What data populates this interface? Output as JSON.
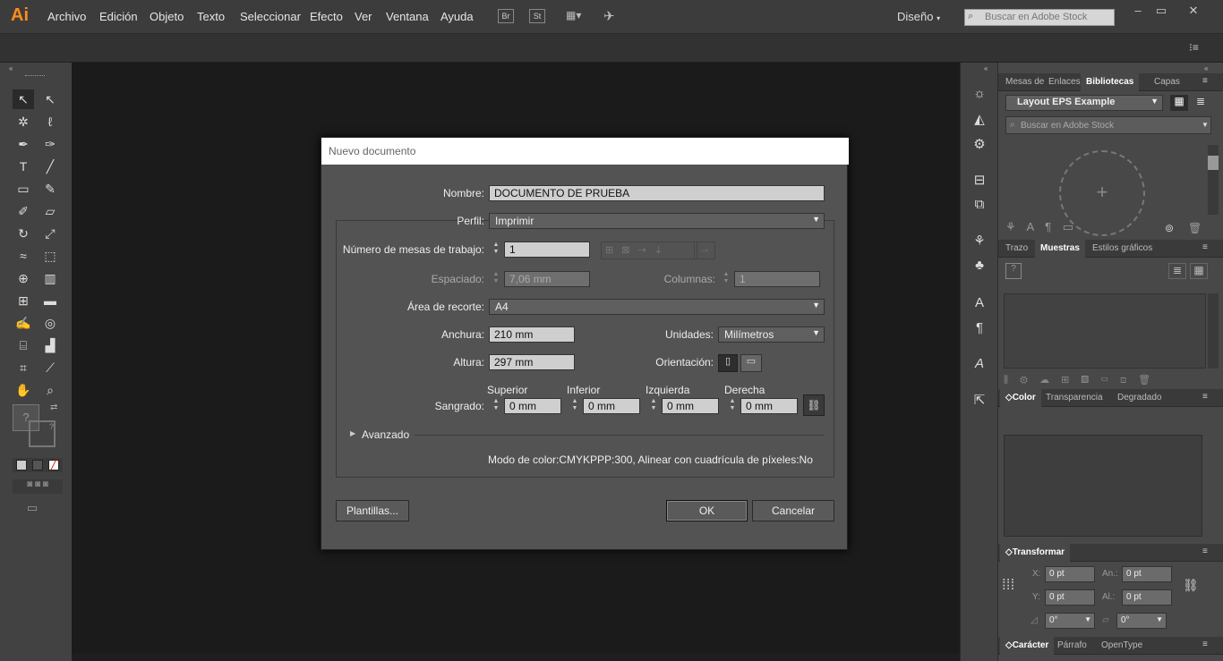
{
  "app": {
    "logo": "Ai",
    "menu": [
      "Archivo",
      "Edición",
      "Objeto",
      "Texto",
      "Seleccionar",
      "Efecto",
      "Ver",
      "Ventana",
      "Ayuda"
    ],
    "br": "Br",
    "st": "St",
    "workspace": "Diseño",
    "stock_search_placeholder": "Buscar en Adobe Stock"
  },
  "dialog": {
    "title": "Nuevo documento",
    "nombre_label": "Nombre:",
    "nombre_value": "DOCUMENTO DE PRUEBA",
    "perfil_label": "Perfil:",
    "perfil_value": "Imprimir",
    "mesas_label": "Número de mesas de trabajo:",
    "mesas_value": "1",
    "espaciado_label": "Espaciado:",
    "espaciado_value": "7,06 mm",
    "columnas_label": "Columnas:",
    "columnas_value": "1",
    "area_label": "Área de recorte:",
    "area_value": "A4",
    "anchura_label": "Anchura:",
    "anchura_value": "210 mm",
    "unidades_label": "Unidades:",
    "unidades_value": "Milímetros",
    "altura_label": "Altura:",
    "altura_value": "297 mm",
    "orientacion_label": "Orientación:",
    "sangrado_label": "Sangrado:",
    "superior_label": "Superior",
    "superior_value": "0 mm",
    "inferior_label": "Inferior",
    "inferior_value": "0 mm",
    "izquierda_label": "Izquierda",
    "izquierda_value": "0 mm",
    "derecha_label": "Derecha",
    "derecha_value": "0 mm",
    "avanzado_label": "Avanzado",
    "info": "Modo de color:CMYKPPP:300, Alinear con cuadrícula de píxeles:No",
    "plantillas_label": "Plantillas...",
    "ok_label": "OK",
    "cancel_label": "Cancelar"
  },
  "panels": {
    "top_tabs": [
      "Mesas de",
      "Enlaces",
      "Bibliotecas",
      "Capas"
    ],
    "library_name": "Layout EPS Example",
    "library_search": "Buscar en Adobe Stock",
    "mid_tabs": [
      "Trazo",
      "Muestras",
      "Estilos gráficos"
    ],
    "color_tabs": [
      "Color",
      "Transparencia",
      "Degradado"
    ],
    "transform_tab": "Transformar",
    "x_label": "X:",
    "x_value": "0 pt",
    "y_label": "Y:",
    "y_value": "0 pt",
    "an_label": "An.:",
    "an_value": "0 pt",
    "al_label": "Al.:",
    "al_value": "0 pt",
    "rot_value": "0°",
    "shear_value": "0°",
    "bottom_tabs": [
      "Carácter",
      "Párrafo",
      "OpenType"
    ]
  }
}
